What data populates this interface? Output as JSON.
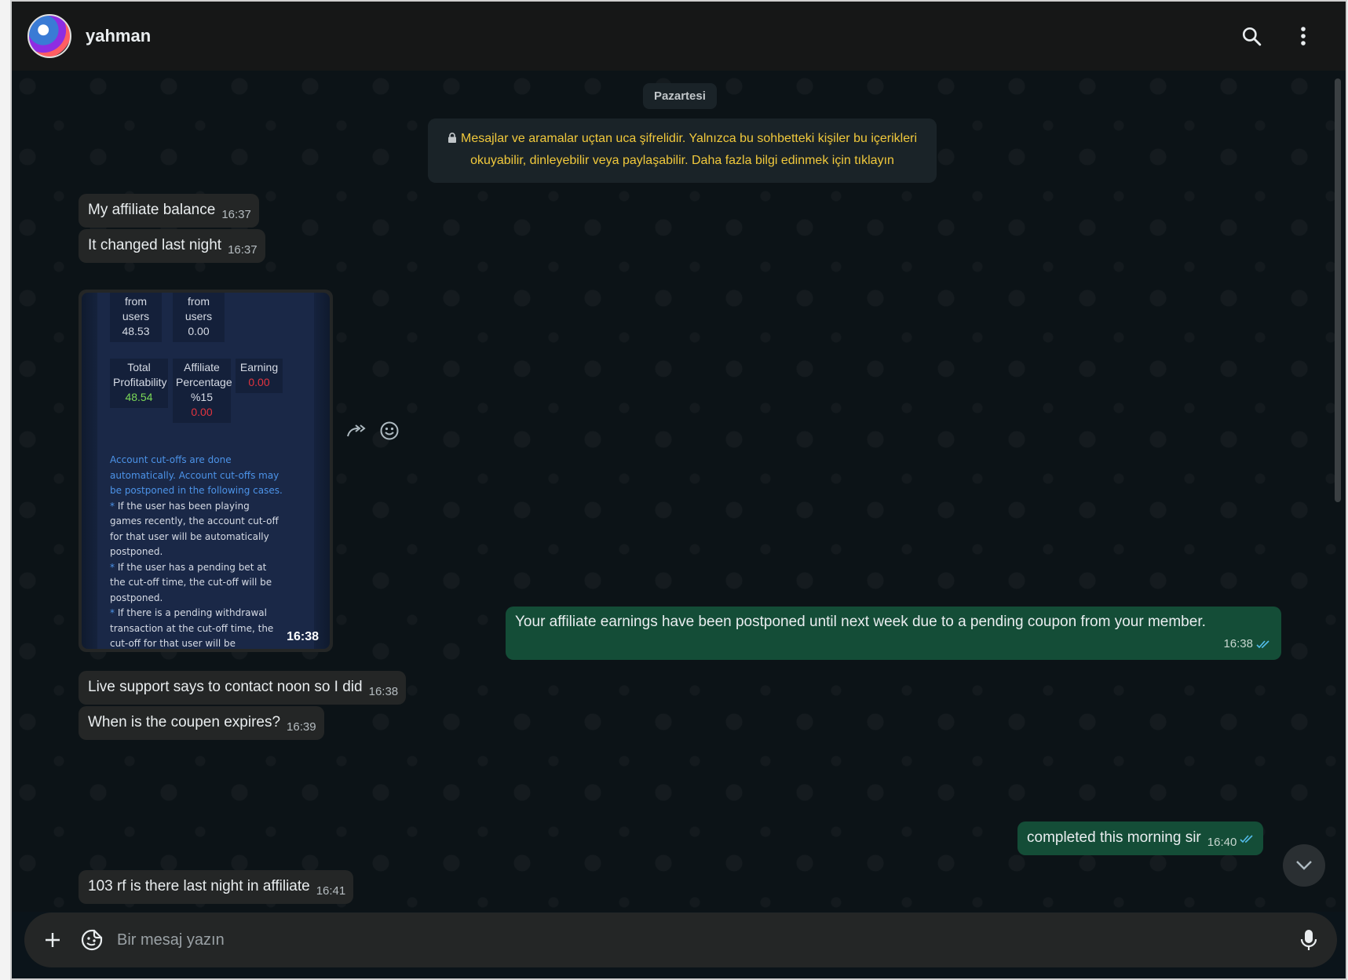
{
  "header": {
    "contact_name": "yahman",
    "icons": [
      "search-icon",
      "menu-dots-icon"
    ]
  },
  "chat": {
    "date_chip": "Pazartesi",
    "encryption_notice": "Mesajlar ve aramalar uçtan uca şifrelidir. Yalnızca bu sohbetteki kişiler bu içerikleri okuyabilir, dinleyebilir veya paylaşabilir. Daha fazla bilgi edinmek için tıklayın",
    "messages": [
      {
        "direction": "in",
        "text": "My affiliate balance",
        "time": "16:37"
      },
      {
        "direction": "in",
        "text": "It changed last night",
        "time": "16:37"
      },
      {
        "direction": "in",
        "type": "image",
        "time": "16:38"
      },
      {
        "direction": "out",
        "text": "Your affiliate earnings have been postponed until next week due to a pending coupon from your member.",
        "time": "16:38",
        "status": "read"
      },
      {
        "direction": "in",
        "text": "Live support says to contact noon so I did",
        "time": "16:38"
      },
      {
        "direction": "in",
        "text": "When is the coupen expires?",
        "time": "16:39"
      },
      {
        "direction": "out",
        "text": "completed this morning sir",
        "time": "16:40",
        "status": "read"
      },
      {
        "direction": "in",
        "text": "103 rf is there last night in affiliate",
        "time": "16:41"
      }
    ],
    "image_content": {
      "stat1_label1": "from",
      "stat1_label2": "users",
      "stat1_value": "48.53",
      "stat2_label1": "from",
      "stat2_label2": "users",
      "stat2_value": "0.00",
      "total_label1": "Total",
      "total_label2": "Profitability",
      "total_value": "48.54",
      "affiliate_label1": "Affiliate",
      "affiliate_label2": "Percentage",
      "affiliate_pct": "%15",
      "affiliate_value": "0.00",
      "earning_label": "Earning",
      "earning_value": "0.00",
      "note_intro": "Account cut-offs are done automatically. Account cut-offs may be postponed in the following cases.",
      "note_1": "If the user has been playing games recently, the account cut-off for that user will be automatically postponed.",
      "note_2": "If the user has a pending bet at the cut-off time, the cut-off will be postponed.",
      "note_3": "If there is a pending withdrawal transaction at the cut-off time, the cut-off for that user will be postponed."
    }
  },
  "composer": {
    "placeholder": "Bir mesaj yazın"
  },
  "colors": {
    "header_bg": "#161717",
    "incoming_bubble": "#242626",
    "outgoing_bubble": "#144d37",
    "notice_text": "#f1c93c",
    "read_ticks": "#53bdeb"
  }
}
